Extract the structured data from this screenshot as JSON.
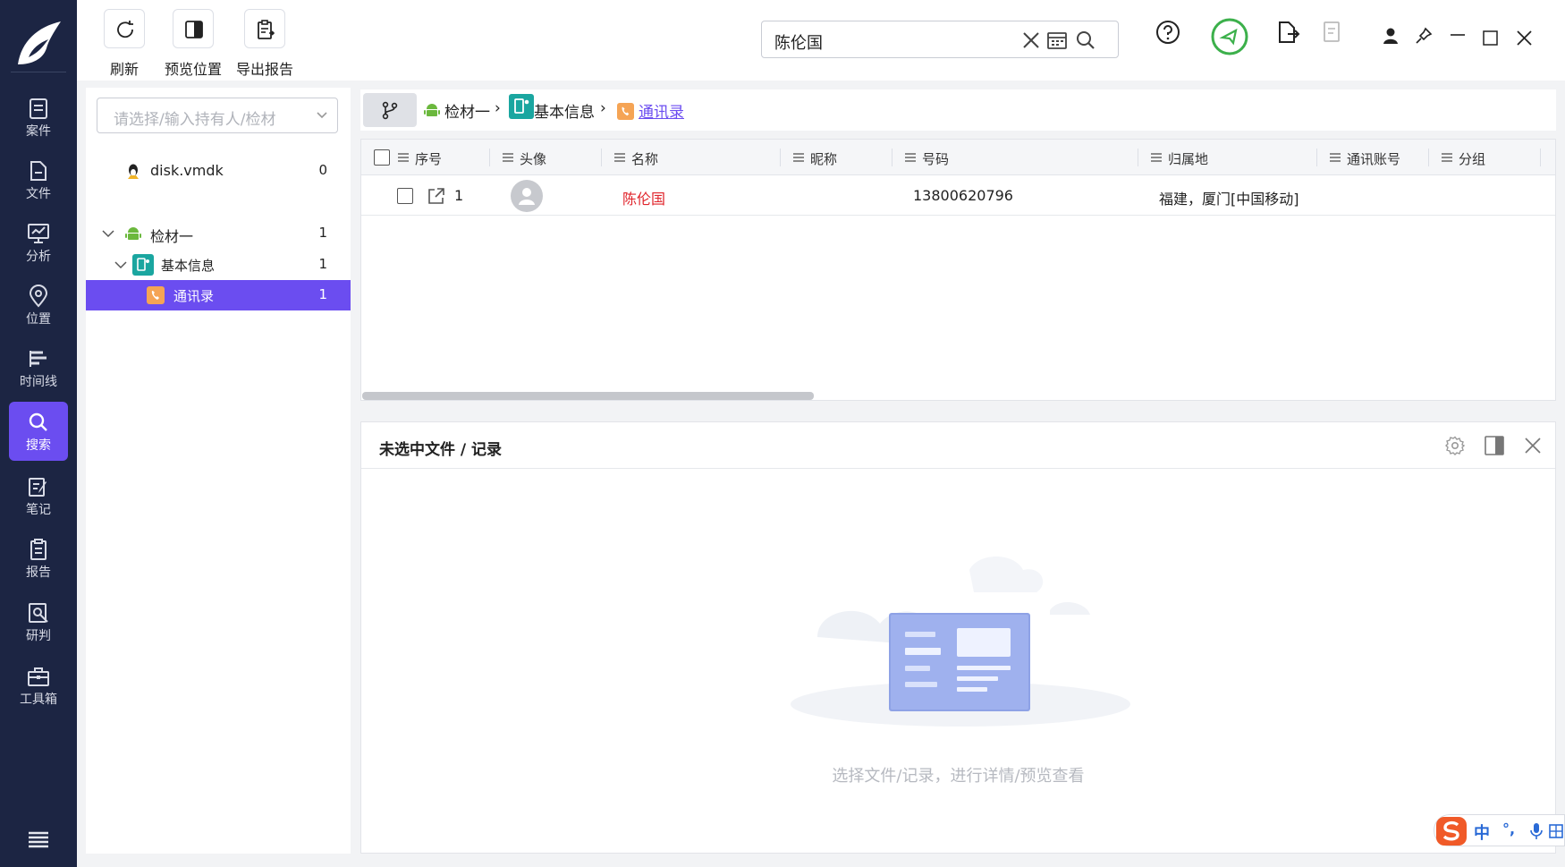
{
  "toolbar": {
    "refresh_label": "刷新",
    "preview_label": "预览位置",
    "export_label": "导出报告"
  },
  "search": {
    "value": "陈伦国"
  },
  "nav": {
    "items": [
      {
        "label": "案件"
      },
      {
        "label": "文件"
      },
      {
        "label": "分析"
      },
      {
        "label": "位置"
      },
      {
        "label": "时间线"
      },
      {
        "label": "搜索"
      },
      {
        "label": "笔记"
      },
      {
        "label": "报告"
      },
      {
        "label": "研判"
      },
      {
        "label": "工具箱"
      }
    ]
  },
  "tree": {
    "select_placeholder": "请选择/输入持有人/检材",
    "nodes": [
      {
        "label": "disk.vmdk",
        "count": "0"
      },
      {
        "label": "检材一",
        "count": "1"
      },
      {
        "label": "基本信息",
        "count": "1"
      },
      {
        "label": "通讯录",
        "count": "1"
      }
    ]
  },
  "breadcrumb": {
    "items": [
      "检材一",
      "基本信息",
      "通讯录"
    ],
    "sep": "›"
  },
  "table": {
    "columns": [
      "序号",
      "头像",
      "名称",
      "昵称",
      "号码",
      "归属地",
      "通讯账号",
      "分组"
    ],
    "rows": [
      {
        "index": "1",
        "name": "陈伦国",
        "nickname": "",
        "number": "13800620796",
        "location": "福建，厦门[中国移动]",
        "account": "",
        "group": ""
      }
    ]
  },
  "detail": {
    "title": "未选中文件 / 记录",
    "empty_text": "选择文件/记录，进行详情/预览查看"
  },
  "ime": {
    "lang": "中",
    "punct": "°,"
  },
  "colors": {
    "accent": "#6b4df0",
    "sidebar": "#1c2543",
    "name_red": "#e0242b",
    "ok_green": "#3cb04b"
  }
}
